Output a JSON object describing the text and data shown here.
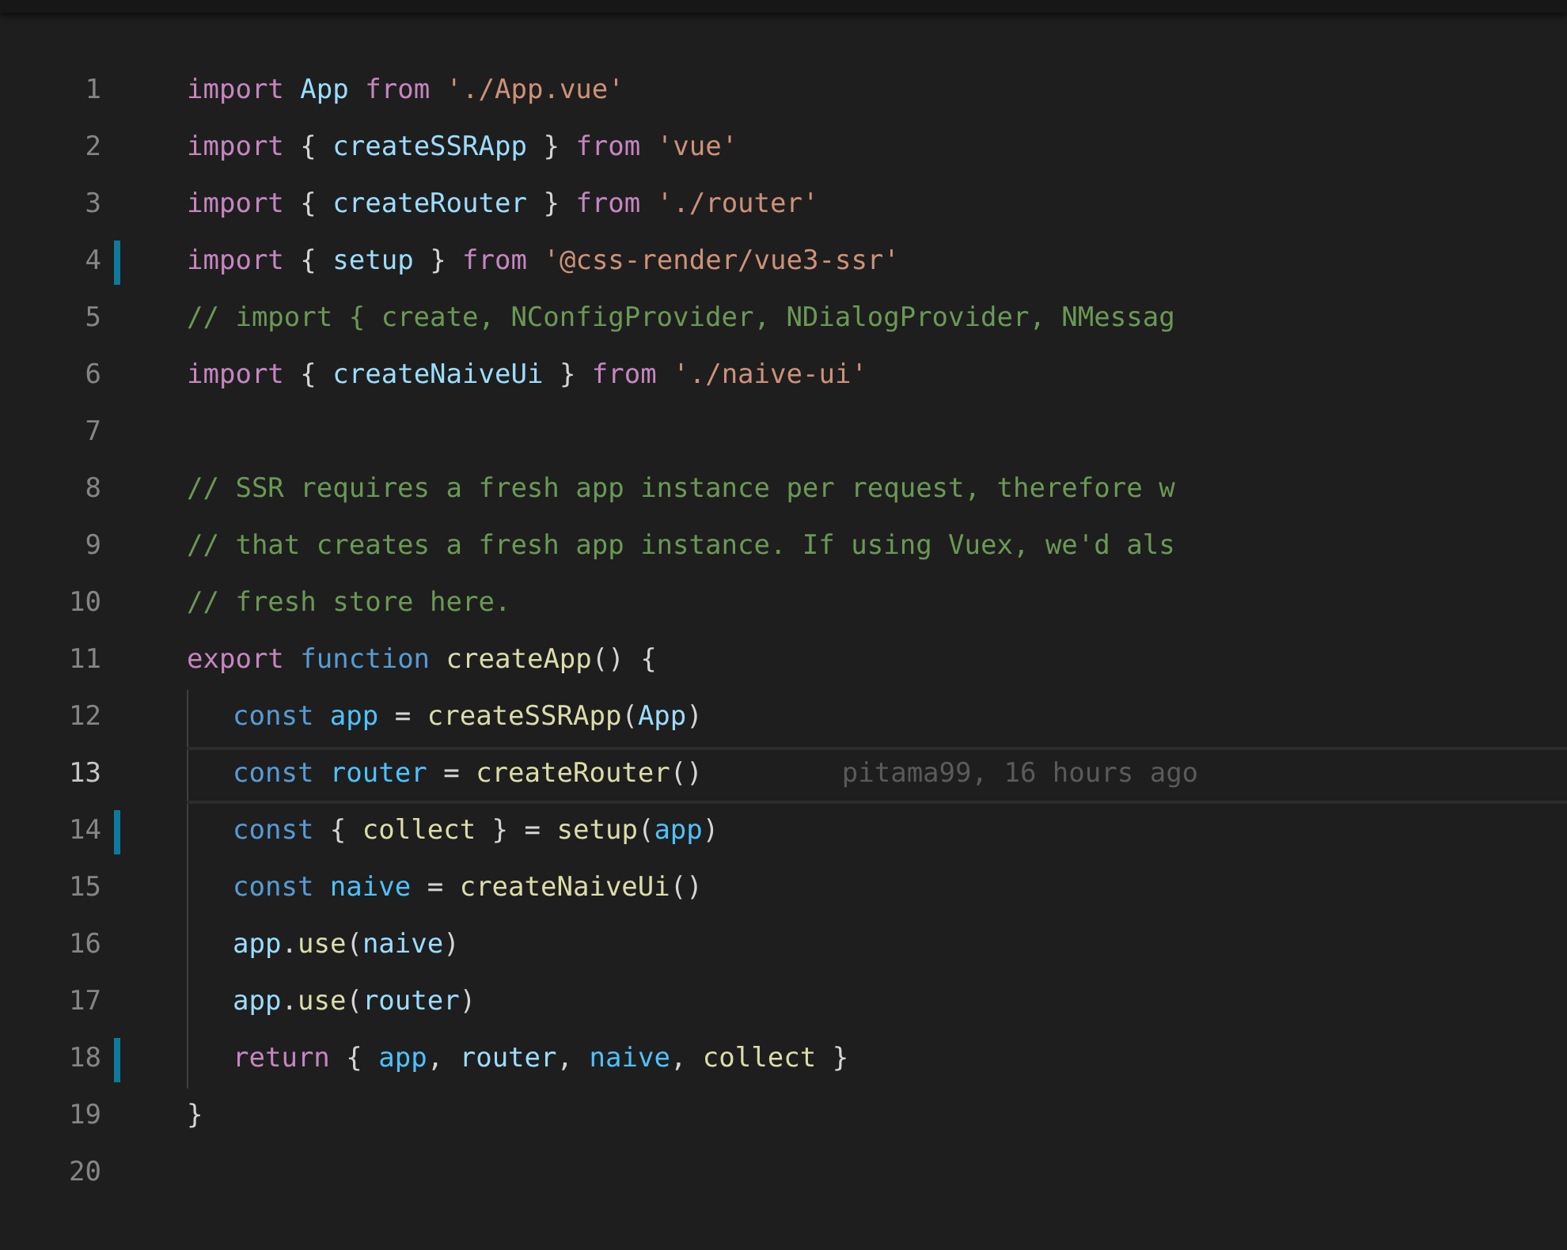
{
  "editor": {
    "lines": [
      {
        "number": "1",
        "modified": false,
        "current": false,
        "indented": false,
        "tokens": [
          {
            "kind": "keyword",
            "text": "import "
          },
          {
            "kind": "variable",
            "text": "App"
          },
          {
            "kind": "keyword",
            "text": " from "
          },
          {
            "kind": "string",
            "text": "'./App.vue'"
          }
        ]
      },
      {
        "number": "2",
        "modified": false,
        "current": false,
        "indented": false,
        "tokens": [
          {
            "kind": "keyword",
            "text": "import "
          },
          {
            "kind": "punct",
            "text": "{ "
          },
          {
            "kind": "variable",
            "text": "createSSRApp"
          },
          {
            "kind": "punct",
            "text": " } "
          },
          {
            "kind": "keyword",
            "text": "from "
          },
          {
            "kind": "string",
            "text": "'vue'"
          }
        ]
      },
      {
        "number": "3",
        "modified": false,
        "current": false,
        "indented": false,
        "tokens": [
          {
            "kind": "keyword",
            "text": "import "
          },
          {
            "kind": "punct",
            "text": "{ "
          },
          {
            "kind": "variable",
            "text": "createRouter"
          },
          {
            "kind": "punct",
            "text": " } "
          },
          {
            "kind": "keyword",
            "text": "from "
          },
          {
            "kind": "string",
            "text": "'./router'"
          }
        ]
      },
      {
        "number": "4",
        "modified": true,
        "current": false,
        "indented": false,
        "tokens": [
          {
            "kind": "keyword",
            "text": "import "
          },
          {
            "kind": "punct",
            "text": "{ "
          },
          {
            "kind": "variable",
            "text": "setup"
          },
          {
            "kind": "punct",
            "text": " } "
          },
          {
            "kind": "keyword",
            "text": "from "
          },
          {
            "kind": "string",
            "text": "'@css-render/vue3-ssr'"
          }
        ]
      },
      {
        "number": "5",
        "modified": false,
        "current": false,
        "indented": false,
        "tokens": [
          {
            "kind": "comment",
            "text": "// import { create, NConfigProvider, NDialogProvider, NMessag"
          }
        ]
      },
      {
        "number": "6",
        "modified": false,
        "current": false,
        "indented": false,
        "tokens": [
          {
            "kind": "keyword",
            "text": "import "
          },
          {
            "kind": "punct",
            "text": "{ "
          },
          {
            "kind": "variable",
            "text": "createNaiveUi"
          },
          {
            "kind": "punct",
            "text": " } "
          },
          {
            "kind": "keyword",
            "text": "from "
          },
          {
            "kind": "string",
            "text": "'./naive-ui'"
          }
        ]
      },
      {
        "number": "7",
        "modified": false,
        "current": false,
        "indented": false
      },
      {
        "number": "8",
        "modified": false,
        "current": false,
        "indented": false,
        "tokens": [
          {
            "kind": "comment",
            "text": "// SSR requires a fresh app instance per request, therefore w"
          }
        ]
      },
      {
        "number": "9",
        "modified": false,
        "current": false,
        "indented": false,
        "tokens": [
          {
            "kind": "comment",
            "text": "// that creates a fresh app instance. If using Vuex, we'd als"
          }
        ]
      },
      {
        "number": "10",
        "modified": false,
        "current": false,
        "indented": false,
        "tokens": [
          {
            "kind": "comment",
            "text": "// fresh store here."
          }
        ]
      },
      {
        "number": "11",
        "modified": false,
        "current": false,
        "indented": false,
        "tokens": [
          {
            "kind": "keyword",
            "text": "export "
          },
          {
            "kind": "storage",
            "text": "function "
          },
          {
            "kind": "function",
            "text": "createApp"
          },
          {
            "kind": "punct",
            "text": "() {"
          }
        ]
      },
      {
        "number": "12",
        "modified": false,
        "current": false,
        "indented": true,
        "tokens": [
          {
            "kind": "storage",
            "text": "const "
          },
          {
            "kind": "constant",
            "text": "app"
          },
          {
            "kind": "punct",
            "text": " = "
          },
          {
            "kind": "function",
            "text": "createSSRApp"
          },
          {
            "kind": "punct",
            "text": "("
          },
          {
            "kind": "variable",
            "text": "App"
          },
          {
            "kind": "punct",
            "text": ")"
          }
        ]
      },
      {
        "number": "13",
        "modified": false,
        "current": true,
        "indented": true,
        "blame": "pitama99, 16 hours ago",
        "tokens": [
          {
            "kind": "storage",
            "text": "const "
          },
          {
            "kind": "constant",
            "text": "router"
          },
          {
            "kind": "punct",
            "text": " = "
          },
          {
            "kind": "function",
            "text": "createRouter"
          },
          {
            "kind": "punct",
            "text": "()"
          }
        ]
      },
      {
        "number": "14",
        "modified": true,
        "current": false,
        "indented": true,
        "tokens": [
          {
            "kind": "storage",
            "text": "const "
          },
          {
            "kind": "punct",
            "text": "{ "
          },
          {
            "kind": "param",
            "text": "collect"
          },
          {
            "kind": "punct",
            "text": " } = "
          },
          {
            "kind": "function",
            "text": "setup"
          },
          {
            "kind": "punct",
            "text": "("
          },
          {
            "kind": "constant",
            "text": "app"
          },
          {
            "kind": "punct",
            "text": ")"
          }
        ]
      },
      {
        "number": "15",
        "modified": false,
        "current": false,
        "indented": true,
        "tokens": [
          {
            "kind": "storage",
            "text": "const "
          },
          {
            "kind": "constant",
            "text": "naive"
          },
          {
            "kind": "punct",
            "text": " = "
          },
          {
            "kind": "function",
            "text": "createNaiveUi"
          },
          {
            "kind": "punct",
            "text": "()"
          }
        ]
      },
      {
        "number": "16",
        "modified": false,
        "current": false,
        "indented": true,
        "tokens": [
          {
            "kind": "variable",
            "text": "app"
          },
          {
            "kind": "punct",
            "text": "."
          },
          {
            "kind": "function",
            "text": "use"
          },
          {
            "kind": "punct",
            "text": "("
          },
          {
            "kind": "variable",
            "text": "naive"
          },
          {
            "kind": "punct",
            "text": ")"
          }
        ]
      },
      {
        "number": "17",
        "modified": false,
        "current": false,
        "indented": true,
        "tokens": [
          {
            "kind": "variable",
            "text": "app"
          },
          {
            "kind": "punct",
            "text": "."
          },
          {
            "kind": "function",
            "text": "use"
          },
          {
            "kind": "punct",
            "text": "("
          },
          {
            "kind": "variable",
            "text": "router"
          },
          {
            "kind": "punct",
            "text": ")"
          }
        ]
      },
      {
        "number": "18",
        "modified": true,
        "current": false,
        "indented": true,
        "tokens": [
          {
            "kind": "keyword",
            "text": "return "
          },
          {
            "kind": "punct",
            "text": "{ "
          },
          {
            "kind": "constant",
            "text": "app"
          },
          {
            "kind": "punct",
            "text": ", "
          },
          {
            "kind": "variable",
            "text": "router"
          },
          {
            "kind": "punct",
            "text": ", "
          },
          {
            "kind": "constant",
            "text": "naive"
          },
          {
            "kind": "punct",
            "text": ", "
          },
          {
            "kind": "param",
            "text": "collect"
          },
          {
            "kind": "punct",
            "text": " }"
          }
        ]
      },
      {
        "number": "19",
        "modified": false,
        "current": false,
        "indented": false,
        "tokens": [
          {
            "kind": "punct",
            "text": "}"
          }
        ]
      },
      {
        "number": "20",
        "modified": false,
        "current": false,
        "indented": false
      }
    ]
  }
}
